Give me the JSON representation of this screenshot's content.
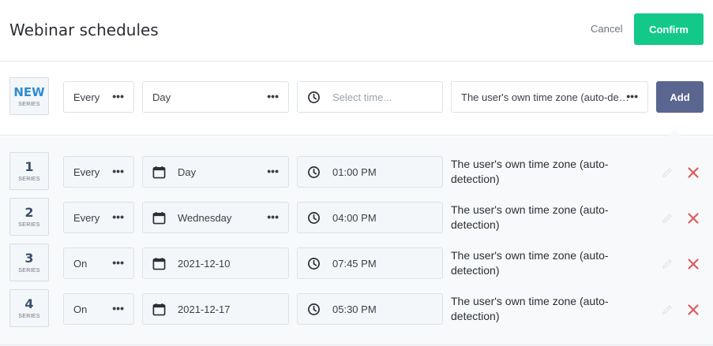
{
  "header": {
    "title": "Webinar schedules",
    "cancel_label": "Cancel",
    "confirm_label": "Confirm"
  },
  "new_series": {
    "badge": "NEW",
    "badge_sub": "SERIES",
    "frequency": "Every",
    "day": "Day",
    "time_placeholder": "Select time...",
    "timezone": "The user's own time zone (auto-detection)",
    "add_label": "Add"
  },
  "series": [
    {
      "num": "1",
      "sub": "SERIES",
      "frequency": "Every",
      "day": "Day",
      "time": "01:00 PM",
      "tz_line1": "The user's own time zone (auto-",
      "tz_line2": "detection)"
    },
    {
      "num": "2",
      "sub": "SERIES",
      "frequency": "Every",
      "day": "Wednesday",
      "time": "04:00 PM",
      "tz_line1": "The user's own time zone (auto-",
      "tz_line2": "detection)"
    },
    {
      "num": "3",
      "sub": "SERIES",
      "frequency": "On",
      "day": "2021-12-10",
      "time": "07:45 PM",
      "tz_line1": "The user's own time zone (auto-",
      "tz_line2": "detection)"
    },
    {
      "num": "4",
      "sub": "SERIES",
      "frequency": "On",
      "day": "2021-12-17",
      "time": "05:30 PM",
      "tz_line1": "The user's own time zone (auto-",
      "tz_line2": "detection)"
    }
  ],
  "icons": {
    "dots": "•••",
    "more": "more-dots-icon",
    "clock": "clock-icon",
    "calendar": "calendar-icon",
    "edit": "pencil-icon",
    "delete": "close-icon"
  },
  "colors": {
    "confirm": "#12c98a",
    "add": "#5b6690",
    "delete": "#e05a5a",
    "badge_new": "#2f8bd6"
  }
}
